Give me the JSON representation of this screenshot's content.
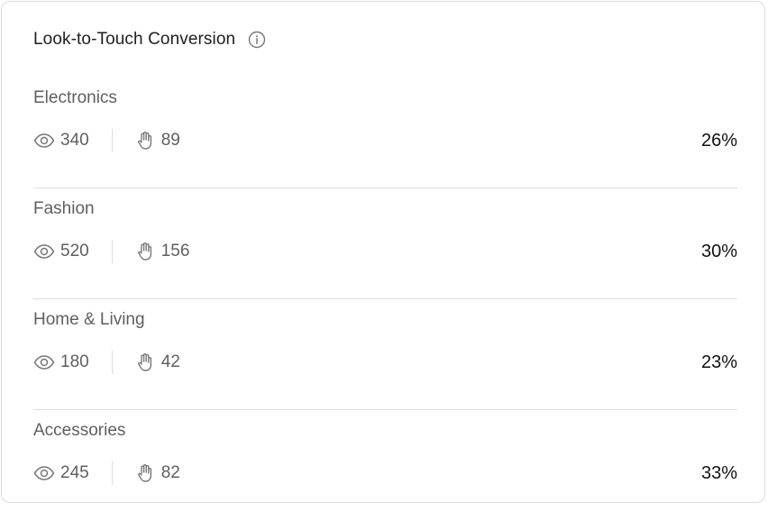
{
  "card": {
    "title": "Look-to-Touch Conversion",
    "info_icon": "info-icon"
  },
  "rows": [
    {
      "category": "Electronics",
      "views": "340",
      "touches": "89",
      "rate": "26%"
    },
    {
      "category": "Fashion",
      "views": "520",
      "touches": "156",
      "rate": "30%"
    },
    {
      "category": "Home & Living",
      "views": "180",
      "touches": "42",
      "rate": "23%"
    },
    {
      "category": "Accessories",
      "views": "245",
      "touches": "82",
      "rate": "33%"
    }
  ],
  "icons": {
    "views": "eye-icon",
    "touches": "hand-icon"
  },
  "colors": {
    "text_primary": "#1f1f1f",
    "text_secondary": "#5f5f5f",
    "divider": "#dedede"
  }
}
